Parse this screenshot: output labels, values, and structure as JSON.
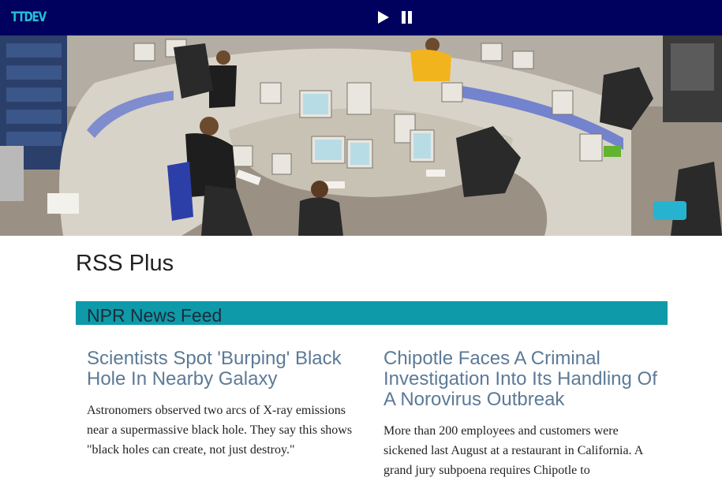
{
  "header": {
    "logo_text": "TTDEV",
    "play_icon": "play-icon",
    "pause_icon": "pause-icon",
    "background_color": "#00005e",
    "logo_color": "#25c0d8"
  },
  "hero": {
    "image_subject": "newsroom-photo"
  },
  "page": {
    "title": "RSS Plus"
  },
  "feed": {
    "title": "NPR News Feed",
    "accent_color": "#0e9aa8",
    "articles": [
      {
        "title": "Scientists Spot 'Burping' Black Hole In Nearby Galaxy",
        "summary": "Astronomers observed two arcs of X-ray emissions near a supermassive black hole. They say this shows \"black holes can create, not just destroy.\""
      },
      {
        "title": "Chipotle Faces A Criminal Investigation Into Its Handling Of A Norovirus Outbreak",
        "summary": "More than 200 employees and customers were sickened last August at a restaurant in California. A grand jury subpoena requires Chipotle to"
      }
    ]
  }
}
